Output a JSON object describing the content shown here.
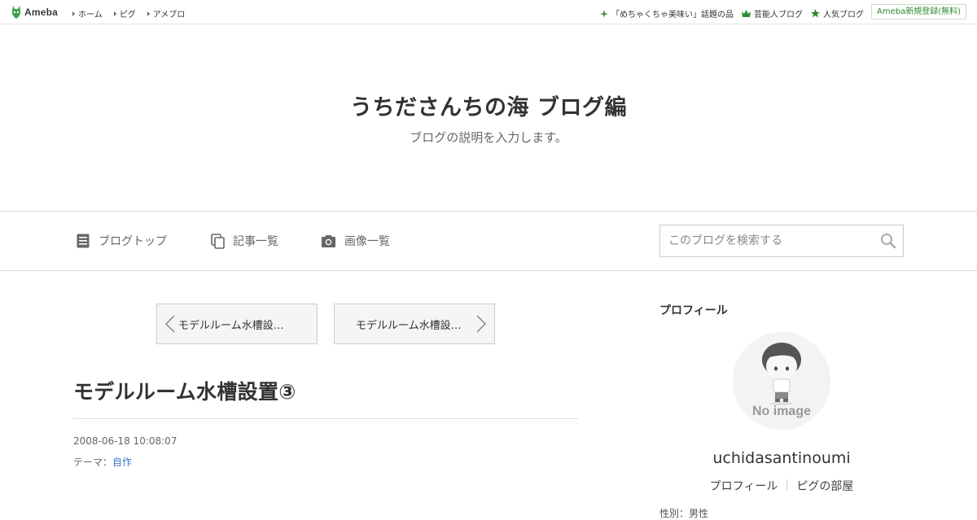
{
  "topbar": {
    "logo_text": "Ameba",
    "nav": [
      "ホーム",
      "ピグ",
      "アメブロ"
    ],
    "right_links": [
      "「めちゃくちゃ美味い」話題の品",
      "芸能人ブログ",
      "人気ブログ"
    ],
    "signup": "Ameba新規登録(無料)",
    "accent": "#2d8a2d"
  },
  "blog": {
    "title": "うちださんちの海 ブログ編",
    "description": "ブログの説明を入力します。"
  },
  "blog_nav": {
    "items": [
      "ブログトップ",
      "記事一覧",
      "画像一覧"
    ],
    "search_placeholder": "このブログを検索する"
  },
  "pager": {
    "prev": "モデルルーム水槽設…",
    "next": "モデルルーム水槽設…"
  },
  "entry": {
    "title": "モデルルーム水槽設置③",
    "date": "2008-06-18 10:08:07",
    "theme_label": "テーマ：",
    "theme": "自作"
  },
  "sidebar": {
    "heading": "プロフィール",
    "no_image": "No image",
    "name": "uchidasantinoumi",
    "links": [
      "プロフィール",
      "ピグの部屋"
    ],
    "cut_text": "性別：男性"
  }
}
